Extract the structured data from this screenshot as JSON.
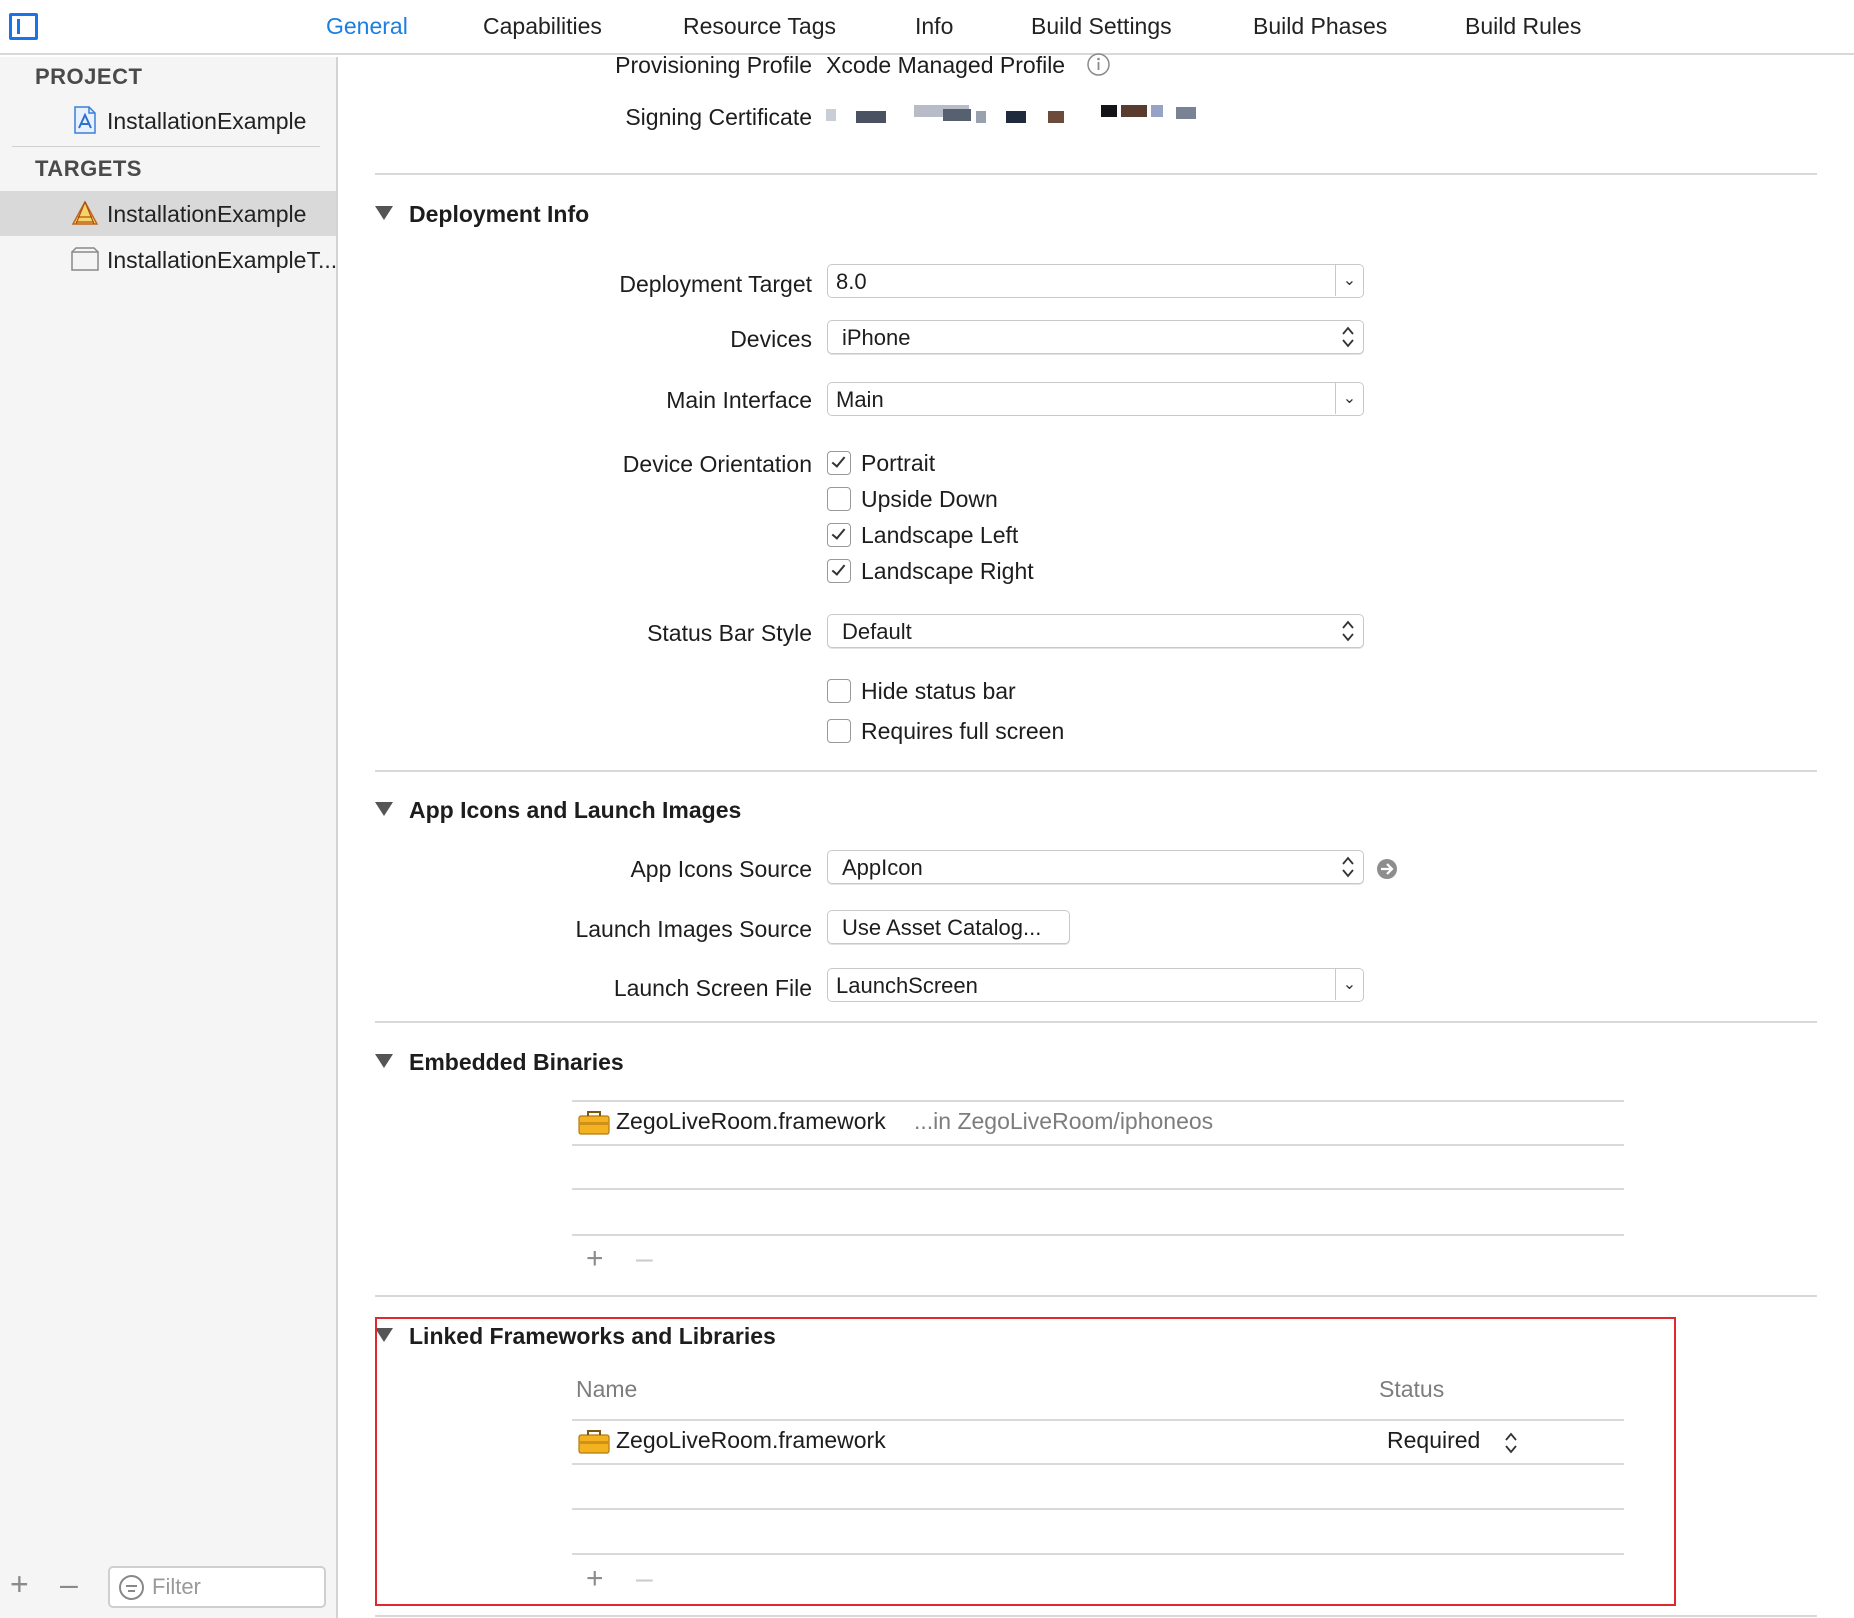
{
  "tabs": [
    "General",
    "Capabilities",
    "Resource Tags",
    "Info",
    "Build Settings",
    "Build Phases",
    "Build Rules"
  ],
  "active_tab": "General",
  "sidebar": {
    "project_header": "PROJECT",
    "project_item": "InstallationExample",
    "targets_header": "TARGETS",
    "target_items": [
      "InstallationExample",
      "InstallationExampleT..."
    ],
    "filter_placeholder": "Filter"
  },
  "signing": {
    "provisioning_profile_label": "Provisioning Profile",
    "provisioning_profile_value": "Xcode Managed Profile",
    "signing_certificate_label": "Signing Certificate"
  },
  "deployment_info": {
    "title": "Deployment Info",
    "deployment_target_label": "Deployment Target",
    "deployment_target_value": "8.0",
    "devices_label": "Devices",
    "devices_value": "iPhone",
    "main_interface_label": "Main Interface",
    "main_interface_value": "Main",
    "device_orientation_label": "Device Orientation",
    "orientations": [
      {
        "label": "Portrait",
        "checked": true
      },
      {
        "label": "Upside Down",
        "checked": false
      },
      {
        "label": "Landscape Left",
        "checked": true
      },
      {
        "label": "Landscape Right",
        "checked": true
      }
    ],
    "status_bar_style_label": "Status Bar Style",
    "status_bar_style_value": "Default",
    "hide_status_bar_label": "Hide status bar",
    "hide_status_bar_checked": false,
    "requires_full_screen_label": "Requires full screen",
    "requires_full_screen_checked": false
  },
  "app_icons": {
    "title": "App Icons and Launch Images",
    "app_icons_source_label": "App Icons Source",
    "app_icons_source_value": "AppIcon",
    "launch_images_source_label": "Launch Images Source",
    "launch_images_source_button": "Use Asset Catalog...",
    "launch_screen_file_label": "Launch Screen File",
    "launch_screen_file_value": "LaunchScreen"
  },
  "embedded_binaries": {
    "title": "Embedded Binaries",
    "items": [
      {
        "name": "ZegoLiveRoom.framework",
        "path": "...in ZegoLiveRoom/iphoneos"
      }
    ]
  },
  "linked_frameworks": {
    "title": "Linked Frameworks and Libraries",
    "col_name": "Name",
    "col_status": "Status",
    "items": [
      {
        "name": "ZegoLiveRoom.framework",
        "status": "Required"
      }
    ]
  },
  "colors": {
    "accent": "#1a7fe0",
    "highlight_box": "#e0282e"
  }
}
